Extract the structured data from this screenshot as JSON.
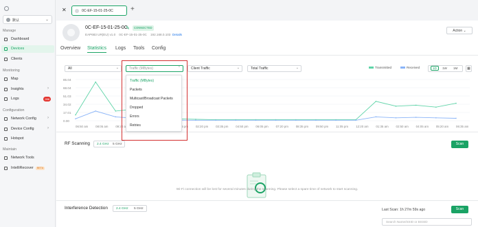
{
  "sidebar": {
    "site": "默认",
    "sections": {
      "manage": "Manage",
      "monitoring": "Monitoring",
      "configuration": "Configuration",
      "maintain": "Maintain"
    },
    "items": [
      {
        "label": "Dashboard"
      },
      {
        "label": "Devices"
      },
      {
        "label": "Clients"
      },
      {
        "label": "Map"
      },
      {
        "label": "Insights"
      },
      {
        "label": "Logs",
        "badge": "288"
      },
      {
        "label": "Network Config"
      },
      {
        "label": "Device Config"
      },
      {
        "label": "Hotspot"
      },
      {
        "label": "Network Tools"
      },
      {
        "label": "IntelliRecover",
        "tag": "BETA"
      }
    ]
  },
  "topbar": {
    "device_tab": "0C-EF-15-01-25-0C"
  },
  "device": {
    "name": "0C-EF-15-01-25-0C",
    "status": "CONNECTED",
    "model": "EAP683 UR(EU) v1.0",
    "mac": "0C-EF-15-01-25-0C",
    "ip": "192.168.0.103",
    "details_link": "Details",
    "action_button": "Action"
  },
  "tabs": [
    "Overview",
    "Statistics",
    "Logs",
    "Tools",
    "Config"
  ],
  "filters": {
    "scope": "All",
    "metric": "Traffic (MBytes)",
    "client": "Client Traffic",
    "total": "Total Traffic"
  },
  "legend": {
    "transmitted": "Transmitted",
    "received": "Received"
  },
  "range": {
    "options": [
      "1D",
      "1W",
      "1M"
    ],
    "selected": "1D"
  },
  "menu": {
    "items": [
      "Traffic (MBytes)",
      "Packets",
      "Multicast/Broadcast Packets",
      "Dropped",
      "Errors",
      "Retries"
    ],
    "selected": "Traffic (MBytes)"
  },
  "chart_data": {
    "type": "line",
    "ylabel_ticks": [
      "85.04",
      "68.04",
      "51.03",
      "34.02",
      "17.01",
      "0.00"
    ],
    "ylim": [
      0,
      85.04
    ],
    "categories": [
      "06:50 am",
      "08:05 am",
      "09:20 am",
      "10:35 am",
      "11:50 am",
      "01:05 pm",
      "02:20 pm",
      "03:35 pm",
      "04:50 pm",
      "06:05 pm",
      "07:20 pm",
      "08:35 pm",
      "09:50 pm",
      "11:05 pm",
      "12:20 am",
      "01:35 am",
      "02:50 am",
      "04:05 am",
      "05:20 am",
      "06:35 am"
    ],
    "series": [
      {
        "name": "Transmitted",
        "values": [
          12,
          80,
          20,
          24,
          6,
          4,
          3,
          2,
          2,
          2,
          2,
          2,
          2,
          2,
          2,
          40,
          30,
          32,
          28,
          36
        ]
      },
      {
        "name": "Received",
        "values": [
          4,
          20,
          8,
          5,
          2,
          1,
          1,
          1,
          1,
          1,
          1,
          1,
          1,
          1,
          1,
          8,
          6,
          7,
          6,
          5
        ]
      }
    ],
    "colors": {
      "transmitted": "#5fd4a8",
      "received": "#8ab4f8"
    }
  },
  "rf": {
    "title": "RF Scanning",
    "bands": [
      "2.4 GHz",
      "5 GHz"
    ],
    "scan": "Scan",
    "empty": "Wi-Fi connection will be lost for several minutes during the scanning. Please select a spare time of network to start scanning."
  },
  "interference": {
    "title": "Interference Detection",
    "bands": [
      "2.4 GHz",
      "5 GHz"
    ],
    "last_scan": "Last Scan: 1h 27m 59s ago",
    "scan": "Scan",
    "search_placeholder": "Search Name/SSID or BSSID"
  }
}
